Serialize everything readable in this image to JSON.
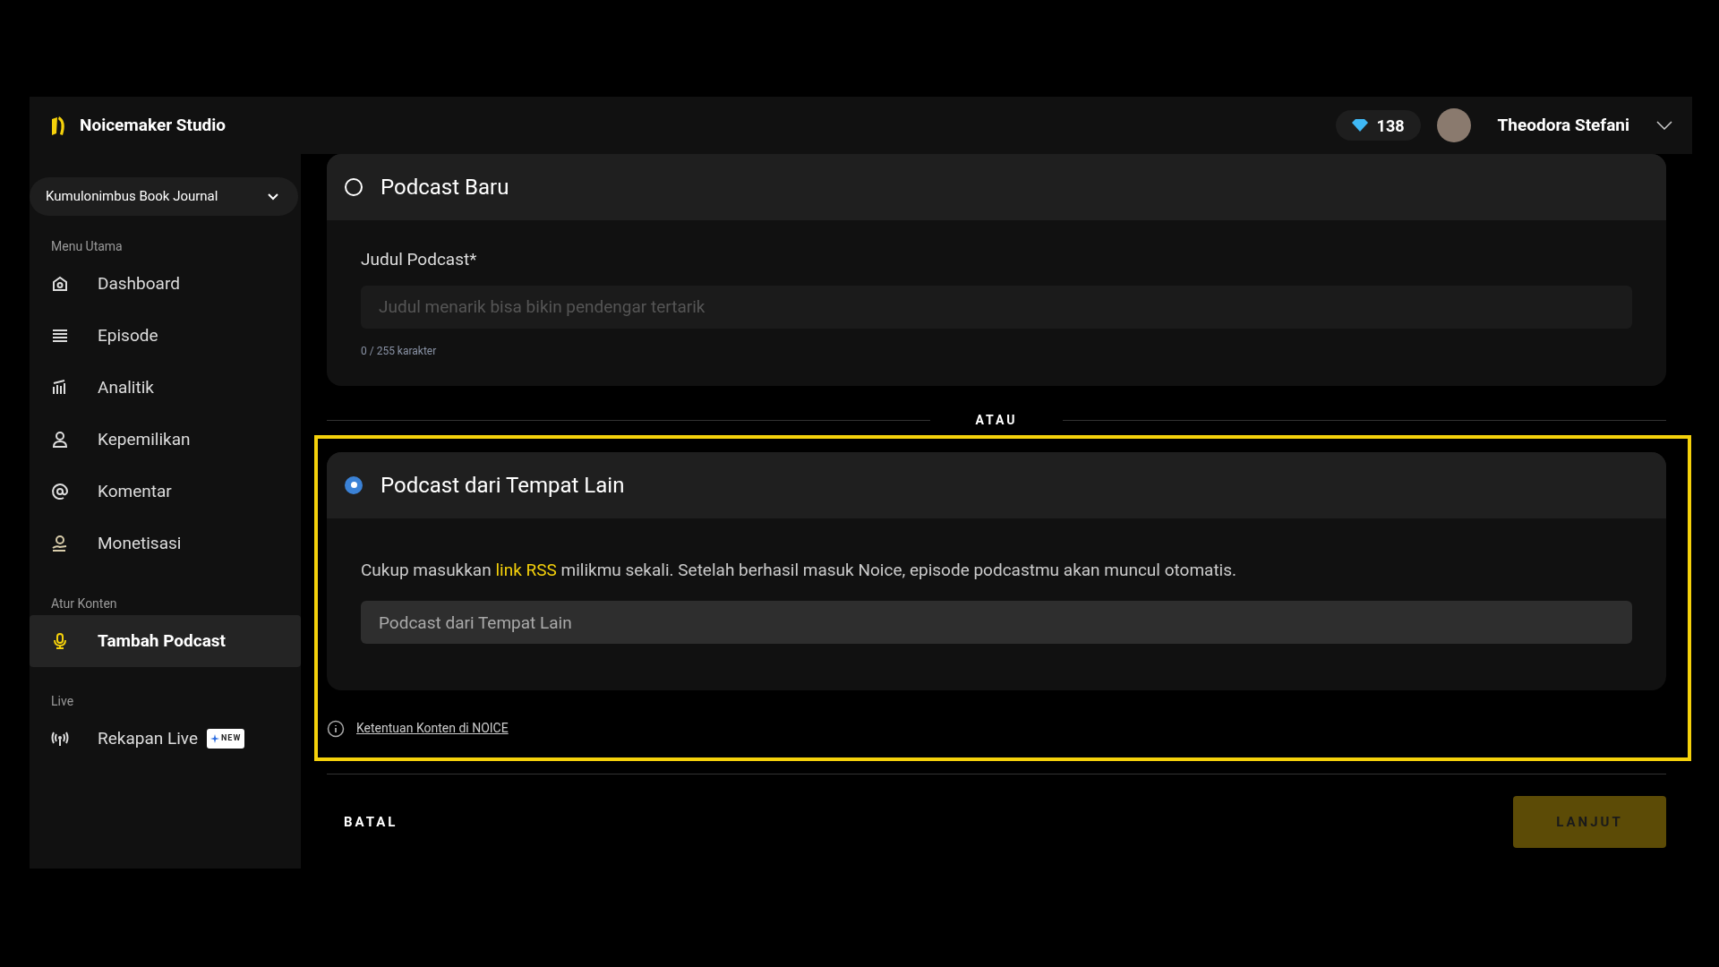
{
  "header": {
    "brand": "Noicemaker Studio",
    "points": "138",
    "user_name": "Theodora Stefani"
  },
  "sidebar": {
    "podcast_selector": "Kumulonimbus Book Journal",
    "sections": [
      {
        "title": "Menu Utama",
        "items": [
          {
            "label": "Dashboard",
            "kind": "home",
            "selected": false
          },
          {
            "label": "Episode",
            "kind": "list",
            "selected": false
          },
          {
            "label": "Analitik",
            "kind": "chart",
            "selected": false
          },
          {
            "label": "Kepemilikan",
            "kind": "person",
            "selected": false
          },
          {
            "label": "Komentar",
            "kind": "at",
            "selected": false
          },
          {
            "label": "Monetisasi",
            "kind": "money",
            "selected": false
          }
        ]
      },
      {
        "title": "Atur Konten",
        "items": [
          {
            "label": "Tambah Podcast",
            "kind": "mic",
            "selected": true
          }
        ]
      },
      {
        "title": "Live",
        "items": [
          {
            "label": "Rekapan Live",
            "kind": "broadcast",
            "selected": false,
            "badge": "NEW"
          }
        ]
      }
    ]
  },
  "options": [
    {
      "kind": "new",
      "title": "Podcast Baru",
      "selected": false,
      "field_label": "Judul Podcast*",
      "placeholder": "Judul menarik bisa bikin pendengar tertarik",
      "counter": "0 / 255 karakter"
    },
    {
      "kind": "rss",
      "title": "Podcast dari Tempat Lain",
      "selected": true,
      "description": [
        {
          "kind": "text",
          "text": "Cukup masukkan "
        },
        {
          "kind": "link",
          "text": "link RSS"
        },
        {
          "kind": "text",
          "text": " milikmu sekali. Setelah berhasil masuk Noice, episode podcastmu akan muncul otomatis."
        }
      ],
      "placeholder": "Podcast dari Tempat Lain"
    }
  ],
  "separator": "ATAU",
  "terms_link": "Ketentuan Konten di NOICE",
  "actions": {
    "cancel": "BATAL",
    "next": "LANJUT"
  }
}
